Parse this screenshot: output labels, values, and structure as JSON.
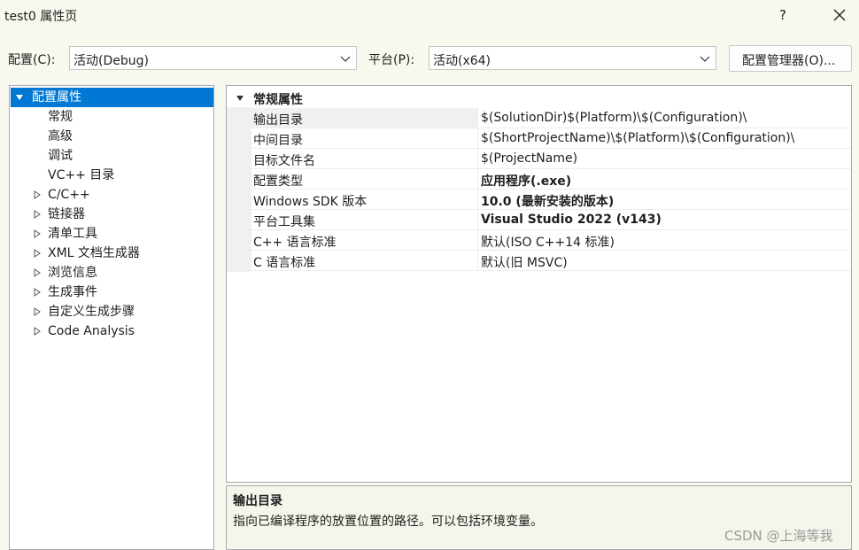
{
  "window": {
    "title": "test0 属性页",
    "help_label": "?"
  },
  "toolbar": {
    "config_label": "配置(C):",
    "config_value": "活动(Debug)",
    "platform_label": "平台(P):",
    "platform_value": "活动(x64)",
    "config_manager_label": "配置管理器(O)..."
  },
  "tree": {
    "root": "配置属性",
    "children": [
      "常规",
      "高级",
      "调试",
      "VC++ 目录"
    ],
    "groups": [
      "C/C++",
      "链接器",
      "清单工具",
      "XML 文档生成器",
      "浏览信息",
      "生成事件",
      "自定义生成步骤",
      "Code Analysis"
    ]
  },
  "grid": {
    "section": "常规属性",
    "rows": [
      {
        "name": "输出目录",
        "value": "$(SolutionDir)$(Platform)\\$(Configuration)\\",
        "bold": false
      },
      {
        "name": "中间目录",
        "value": "$(ShortProjectName)\\$(Platform)\\$(Configuration)\\",
        "bold": false
      },
      {
        "name": "目标文件名",
        "value": "$(ProjectName)",
        "bold": false
      },
      {
        "name": "配置类型",
        "value": "应用程序(.exe)",
        "bold": true
      },
      {
        "name": "Windows SDK 版本",
        "value": "10.0 (最新安装的版本)",
        "bold": true
      },
      {
        "name": "平台工具集",
        "value": "Visual Studio 2022 (v143)",
        "bold": true
      },
      {
        "name": "C++ 语言标准",
        "value": "默认(ISO C++14 标准)",
        "bold": false
      },
      {
        "name": "C 语言标准",
        "value": "默认(旧 MSVC)",
        "bold": false
      }
    ]
  },
  "description": {
    "title": "输出目录",
    "text": "指向已编译程序的放置位置的路径。可以包括环境变量。"
  },
  "watermark": "CSDN @上海等我",
  "colors": {
    "accent": "#0078d4",
    "background": "#f7f8ee"
  }
}
